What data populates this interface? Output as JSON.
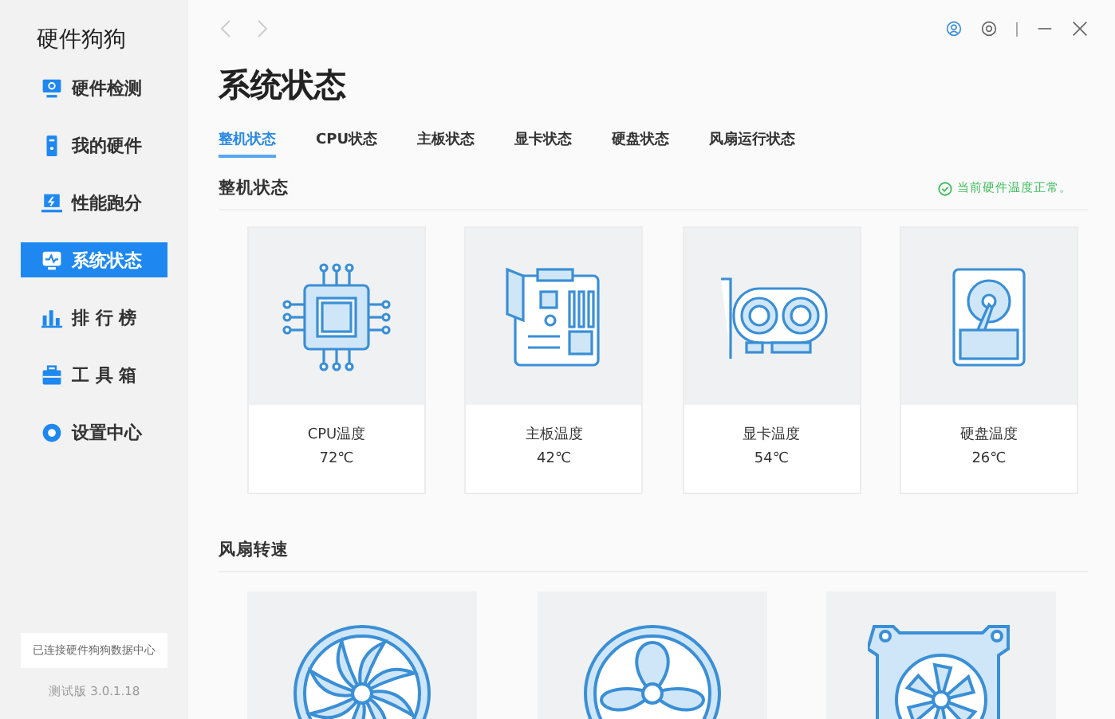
{
  "app": {
    "name": "硬件狗狗"
  },
  "sidebar": {
    "items": [
      {
        "label": "硬件检测",
        "kind": "monitor-search",
        "selected": false
      },
      {
        "label": "我的硬件",
        "kind": "tower",
        "selected": false
      },
      {
        "label": "性能跑分",
        "kind": "laptop",
        "selected": false
      },
      {
        "label": "系统状态",
        "kind": "pulse",
        "selected": true
      },
      {
        "label": "排 行 榜",
        "kind": "bars",
        "selected": false
      },
      {
        "label": "工 具 箱",
        "kind": "toolbox",
        "selected": false
      },
      {
        "label": "设置中心",
        "kind": "gear",
        "selected": false
      }
    ],
    "connection": "已连接硬件狗狗数据中心",
    "version": "测试版 3.0.1.18"
  },
  "page": {
    "title": "系统状态"
  },
  "tabs": [
    {
      "label": "整机状态",
      "selected": true
    },
    {
      "label": "CPU状态",
      "selected": false
    },
    {
      "label": "主板状态",
      "selected": false
    },
    {
      "label": "显卡状态",
      "selected": false
    },
    {
      "label": "硬盘状态",
      "selected": false
    },
    {
      "label": "风扇运行状态",
      "selected": false
    }
  ],
  "overview": {
    "title": "整机状态",
    "status": "当前硬件温度正常。",
    "cards": [
      {
        "kind": "cpu",
        "label": "CPU温度",
        "value": "72℃"
      },
      {
        "kind": "motherboard",
        "label": "主板温度",
        "value": "42℃"
      },
      {
        "kind": "gpu",
        "label": "显卡温度",
        "value": "54℃"
      },
      {
        "kind": "disk",
        "label": "硬盘温度",
        "value": "26℃"
      }
    ]
  },
  "fans": {
    "title": "风扇转速",
    "cards": [
      {
        "kind": "case-fan"
      },
      {
        "kind": "propeller-fan"
      },
      {
        "kind": "radiator-fan"
      }
    ]
  }
}
